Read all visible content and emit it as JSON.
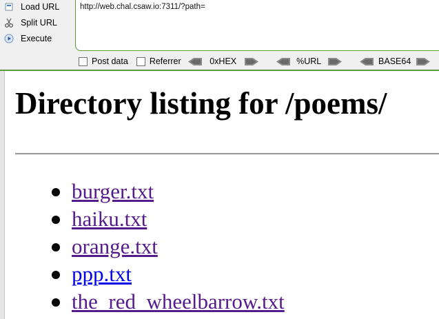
{
  "hackbar": {
    "load_url_label": "Load URL",
    "split_url_label": "Split URL",
    "execute_label": "Execute",
    "url_value": "http://web.chal.csaw.io:7311/?path=",
    "post_data_label": "Post data",
    "referrer_label": "Referrer",
    "hex_label": "0xHEX",
    "url_enc_label": "%URL",
    "base64_label": "BASE64"
  },
  "page": {
    "heading": "Directory listing for /poems/",
    "files": [
      {
        "name": "burger.txt",
        "visited": true
      },
      {
        "name": "haiku.txt",
        "visited": true
      },
      {
        "name": "orange.txt",
        "visited": true
      },
      {
        "name": "ppp.txt",
        "visited": false
      },
      {
        "name": "the_red_wheelbarrow.txt",
        "visited": true
      }
    ]
  },
  "colors": {
    "visited_link": "#551a8b",
    "unvisited_link": "#0000ee",
    "hackbar_border": "#5c9a3a"
  }
}
